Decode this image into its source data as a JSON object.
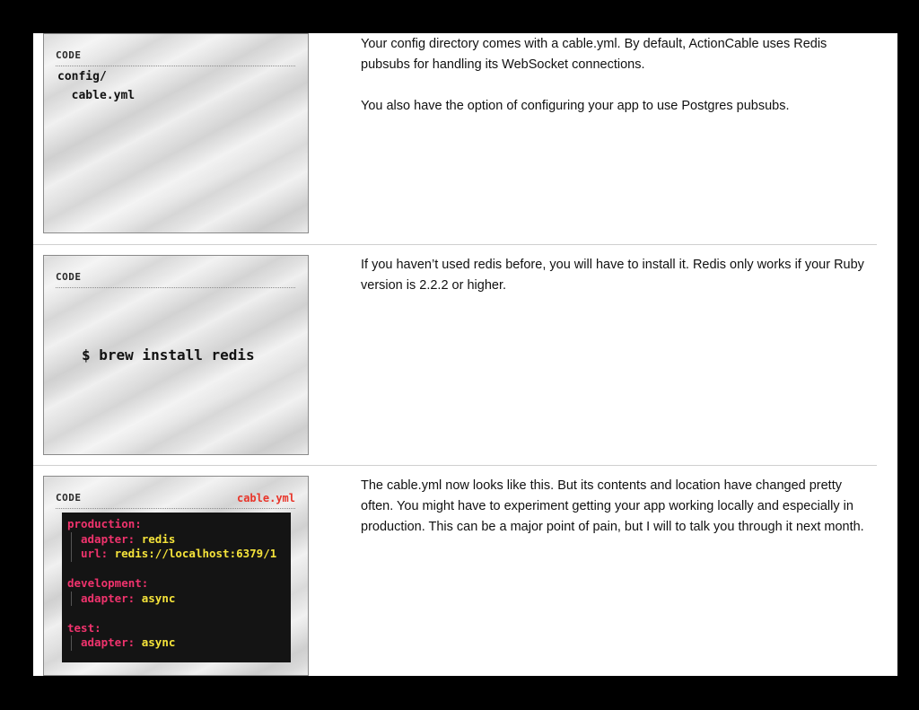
{
  "rows": [
    {
      "code_label": "CODE",
      "lines": [
        "config/",
        "  cable.yml"
      ],
      "paragraph1": "Your config directory comes with a cable.yml. By default, ActionCable uses Redis pubsubs for handling its WebSocket connections.",
      "paragraph2": "You also have the option of configuring your app to use Postgres pubsubs."
    },
    {
      "code_label": "CODE",
      "command": "$ brew install redis",
      "paragraph1": "If you haven’t used redis before, you will have to install it.  Redis only works if your Ruby version is 2.2.2 or higher."
    },
    {
      "code_label": "CODE",
      "file_label": "cable.yml",
      "code": {
        "production": "production:",
        "prod_adapter_key": "adapter:",
        "prod_adapter_val": " redis",
        "prod_url_key": "url:",
        "prod_url_val": " redis://localhost:6379/1",
        "development": "development:",
        "dev_adapter_key": "adapter:",
        "dev_adapter_val": " async",
        "test": "test:",
        "test_adapter_key": "adapter:",
        "test_adapter_val": " async"
      },
      "paragraph1": "The cable.yml now looks like this. But its contents and location have changed pretty often. You might have to experiment getting your app working locally and especially in production. This can be a major point of pain, but I will to talk you through it next month."
    }
  ]
}
